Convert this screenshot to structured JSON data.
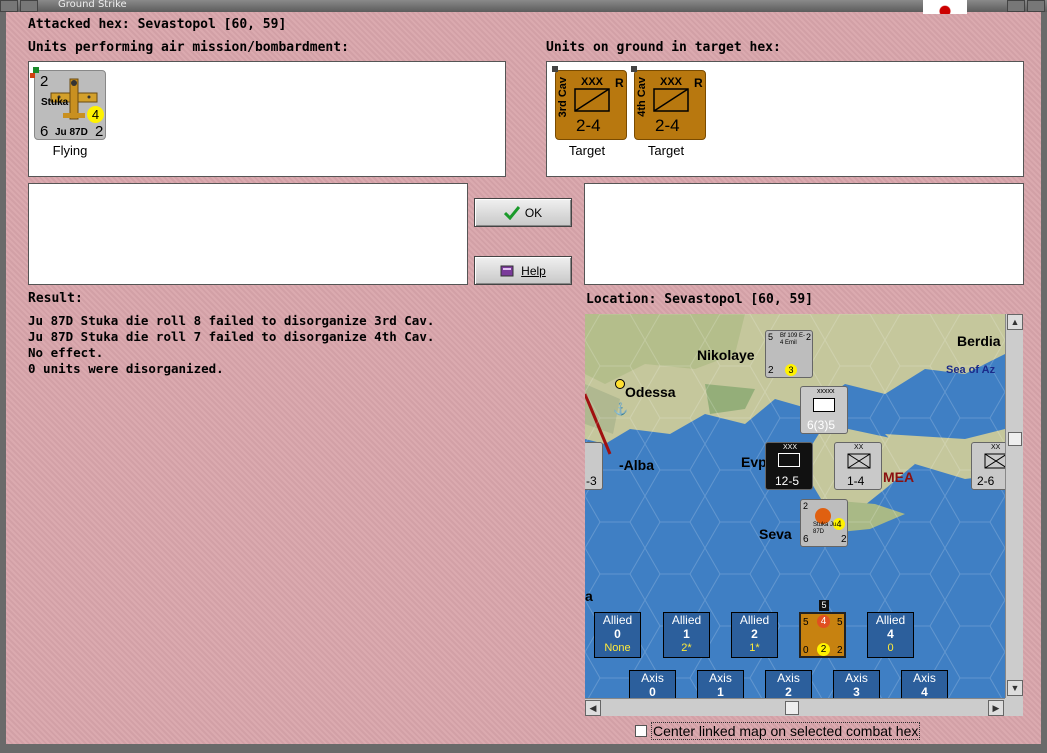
{
  "window": {
    "title": "Ground Strike"
  },
  "header": {
    "attacked_hex": "Attacked hex: Sevastopol  [60, 59]",
    "air_units_label": "Units performing air mission/bombardment:",
    "ground_units_label": "Units on ground in target hex:"
  },
  "air_units": [
    {
      "unit_type": "Stuka",
      "model": "Ju 87D",
      "top_left": "2",
      "factor": "4",
      "bottom_left": "6",
      "bottom_right": "2",
      "status": "Flying"
    }
  ],
  "ground_units": [
    {
      "name": "3rd Cav",
      "size": "XXX",
      "tag": "R",
      "strength": "2-4",
      "status": "Target"
    },
    {
      "name": "4th Cav",
      "size": "XXX",
      "tag": "R",
      "strength": "2-4",
      "status": "Target"
    }
  ],
  "buttons": {
    "ok_label": "OK",
    "help_label": "Help"
  },
  "result": {
    "label": "Result:",
    "lines": [
      "Ju 87D Stuka die roll 8 failed to disorganize 3rd Cav.",
      "Ju 87D Stuka die roll 7 failed to disorganize 4th Cav.",
      "No effect.",
      "0 units were disorganized."
    ]
  },
  "location": {
    "label": "Location:  Sevastopol [60, 59]"
  },
  "map": {
    "place_names": [
      "Nikolaye",
      "Odessa",
      "Berdia",
      "Sea of Az",
      "-Alba",
      "Evp",
      "MEA",
      "Seva",
      "a"
    ],
    "counters": [
      {
        "label": "Bf 109 E-4 Emil",
        "top_left": "5",
        "top_right": "2",
        "bottom_left": "2",
        "factor": "3"
      },
      {
        "label": "xxxxx",
        "value": "6(3)5"
      },
      {
        "label": "XXX",
        "value": "12-5"
      },
      {
        "label": "XX",
        "value": "1-4"
      },
      {
        "label": "XX",
        "value": "2-6"
      },
      {
        "label": "-3",
        "value": "-3"
      },
      {
        "label": "Stuka Ju 87D",
        "top_left": "2",
        "factor": "4",
        "bottom_left": "6",
        "bottom_right": "2"
      }
    ],
    "allied_boxes": [
      {
        "label": "Allied",
        "number": "0",
        "note": "None"
      },
      {
        "label": "Allied",
        "number": "1",
        "note": "2*"
      },
      {
        "label": "Allied",
        "number": "2",
        "note": "1*"
      },
      {
        "label": "Allied",
        "number": "4",
        "note": "0"
      }
    ],
    "center_counter": {
      "top": "5",
      "left": "5",
      "center": "4",
      "right": "5",
      "bottom_left": "0",
      "bottom_center": "2",
      "bottom_right": "2"
    },
    "axis_boxes": [
      {
        "label": "Axis",
        "number": "0"
      },
      {
        "label": "Axis",
        "number": "1"
      },
      {
        "label": "Axis",
        "number": "2"
      },
      {
        "label": "Axis",
        "number": "3"
      },
      {
        "label": "Axis",
        "number": "4"
      }
    ]
  },
  "footer": {
    "center_map_label": "Center linked map on selected combat hex",
    "center_map_checked": false
  },
  "colors": {
    "background": "#d9a5ab",
    "sea": "#3f7fc4",
    "land": "#c7c79a",
    "cav_counter": "#b8780f",
    "air_counter": "#bcbcbc"
  }
}
